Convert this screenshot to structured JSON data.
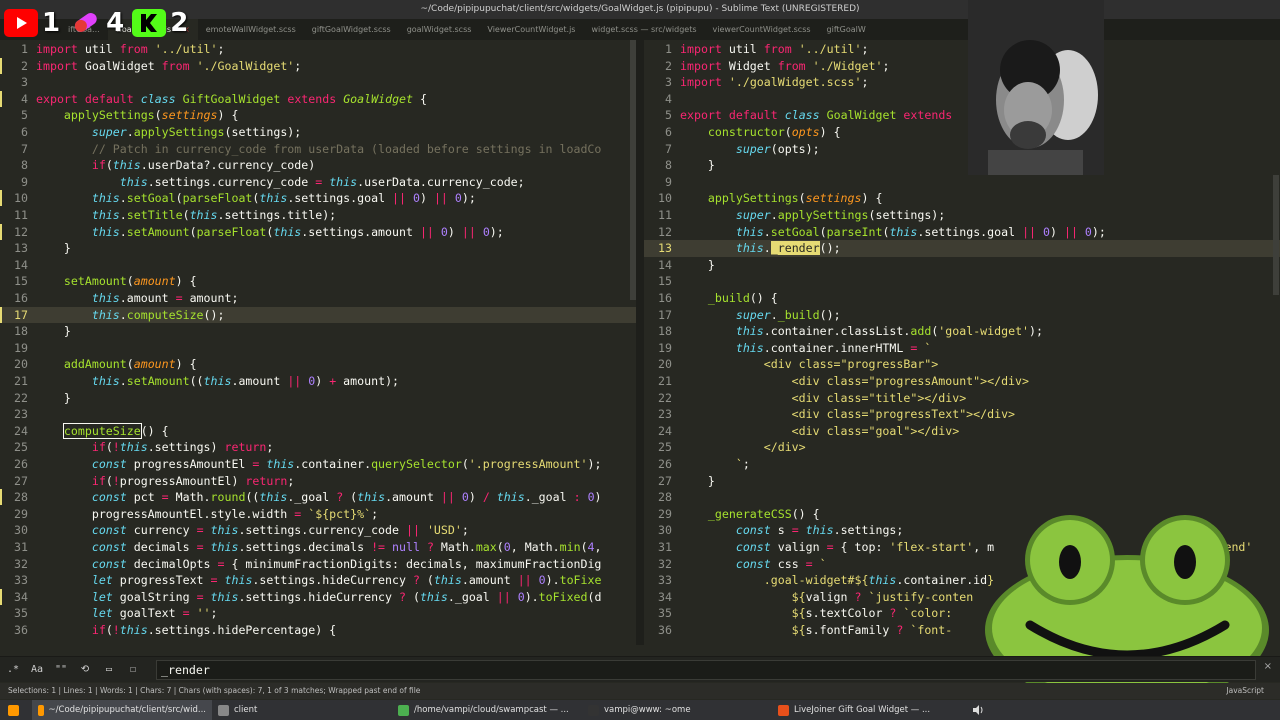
{
  "window_title": "~/Code/pipipupuchat/client/src/widgets/GoalWidget.js (pipipupu) - Sublime Text (UNREGISTERED)",
  "stream_icons": {
    "youtube_count": "1",
    "pill_count": "4",
    "kick_count": "2"
  },
  "tabs": [
    {
      "label": "iftGoa...",
      "active": false
    },
    {
      "label": "GoalWidget.js",
      "active": true
    },
    {
      "label": "emoteWallWidget.scss",
      "active": false
    },
    {
      "label": "giftGoalWidget.scss",
      "active": false
    },
    {
      "label": "goalWidget.scss",
      "active": false
    },
    {
      "label": "ViewerCountWidget.js",
      "active": false
    },
    {
      "label": "widget.scss — src/widgets",
      "active": false
    },
    {
      "label": "viewerCountWidget.scss",
      "active": false
    },
    {
      "label": "giftGoalW",
      "active": false
    }
  ],
  "tab_close_glyph": "×",
  "left_editor": {
    "lines": [
      {
        "n": "1",
        "mod": false,
        "cur": false,
        "html": "<span class='kw'>import</span> util <span class='kw'>from</span> <span class='st'>'../util'</span>;"
      },
      {
        "n": "2",
        "mod": true,
        "cur": false,
        "html": "<span class='kw'>import</span> GoalWidget <span class='kw'>from</span> <span class='st'>'./GoalWidget'</span>;"
      },
      {
        "n": "3",
        "mod": false,
        "cur": false,
        "html": ""
      },
      {
        "n": "4",
        "mod": true,
        "cur": false,
        "html": "<span class='kw'>export</span> <span class='kw'>default</span> <span class='kwi'>class</span> <span class='fn'>GiftGoalWidget</span> <span class='kw'>extends</span> <span class='cl'>GoalWidget</span> {"
      },
      {
        "n": "5",
        "mod": false,
        "cur": false,
        "html": "    <span class='fn'>applySettings</span>(<span class='pa'>settings</span>) {"
      },
      {
        "n": "6",
        "mod": false,
        "cur": false,
        "html": "        <span class='kwi'>super</span>.<span class='fn'>applySettings</span>(settings);"
      },
      {
        "n": "7",
        "mod": false,
        "cur": false,
        "html": "        <span class='cm'>// Patch in currency_code from userData (loaded before settings in loadCo</span>"
      },
      {
        "n": "8",
        "mod": false,
        "cur": false,
        "html": "        <span class='kw'>if</span>(<span class='kwi'>this</span>.userData?.currency_code)"
      },
      {
        "n": "9",
        "mod": false,
        "cur": false,
        "html": "            <span class='kwi'>this</span>.settings.currency_code <span class='kw'>=</span> <span class='kwi'>this</span>.userData.currency_code;"
      },
      {
        "n": "10",
        "mod": true,
        "cur": false,
        "html": "        <span class='kwi'>this</span>.<span class='fn'>setGoal</span>(<span class='fn'>parseFloat</span>(<span class='kwi'>this</span>.settings.goal <span class='kw'>||</span> <span class='nu'>0</span>) <span class='kw'>||</span> <span class='nu'>0</span>);"
      },
      {
        "n": "11",
        "mod": false,
        "cur": false,
        "html": "        <span class='kwi'>this</span>.<span class='fn'>setTitle</span>(<span class='kwi'>this</span>.settings.title);"
      },
      {
        "n": "12",
        "mod": true,
        "cur": false,
        "html": "        <span class='kwi'>this</span>.<span class='fn'>setAmount</span>(<span class='fn'>parseFloat</span>(<span class='kwi'>this</span>.settings.amount <span class='kw'>||</span> <span class='nu'>0</span>) <span class='kw'>||</span> <span class='nu'>0</span>);"
      },
      {
        "n": "13",
        "mod": false,
        "cur": false,
        "html": "    }"
      },
      {
        "n": "14",
        "mod": false,
        "cur": false,
        "html": ""
      },
      {
        "n": "15",
        "mod": false,
        "cur": false,
        "html": "    <span class='fn'>setAmount</span>(<span class='pa'>amount</span>) {"
      },
      {
        "n": "16",
        "mod": false,
        "cur": false,
        "html": "        <span class='kwi'>this</span>.amount <span class='kw'>=</span> amount;"
      },
      {
        "n": "17",
        "mod": true,
        "cur": true,
        "html": "        <span class='kwi'>this</span>.<span class='fn'>computeSize</span>();"
      },
      {
        "n": "18",
        "mod": false,
        "cur": false,
        "html": "    }"
      },
      {
        "n": "19",
        "mod": false,
        "cur": false,
        "html": ""
      },
      {
        "n": "20",
        "mod": false,
        "cur": false,
        "html": "    <span class='fn'>addAmount</span>(<span class='pa'>amount</span>) {"
      },
      {
        "n": "21",
        "mod": false,
        "cur": false,
        "html": "        <span class='kwi'>this</span>.<span class='fn'>setAmount</span>((<span class='kwi'>this</span>.amount <span class='kw'>||</span> <span class='nu'>0</span>) <span class='kw'>+</span> amount);"
      },
      {
        "n": "22",
        "mod": false,
        "cur": false,
        "html": "    }"
      },
      {
        "n": "23",
        "mod": false,
        "cur": false,
        "html": ""
      },
      {
        "n": "24",
        "mod": false,
        "cur": false,
        "html": "    <span class='fn hl'>computeSize</span>() {"
      },
      {
        "n": "25",
        "mod": false,
        "cur": false,
        "html": "        <span class='kw'>if</span>(<span class='kw'>!</span><span class='kwi'>this</span>.settings) <span class='kw'>return</span>;"
      },
      {
        "n": "26",
        "mod": false,
        "cur": false,
        "html": "        <span class='kwi'>const</span> progressAmountEl <span class='kw'>=</span> <span class='kwi'>this</span>.container.<span class='fn'>querySelector</span>(<span class='st'>'.progressAmount'</span>);"
      },
      {
        "n": "27",
        "mod": false,
        "cur": false,
        "html": "        <span class='kw'>if</span>(<span class='kw'>!</span>progressAmountEl) <span class='kw'>return</span>;"
      },
      {
        "n": "28",
        "mod": true,
        "cur": false,
        "html": "        <span class='kwi'>const</span> pct <span class='kw'>=</span> Math.<span class='fn'>round</span>((<span class='kwi'>this</span>._goal <span class='kw'>?</span> (<span class='kwi'>this</span>.amount <span class='kw'>||</span> <span class='nu'>0</span>) <span class='kw'>/</span> <span class='kwi'>this</span>._goal <span class='kw'>:</span> <span class='nu'>0</span>)"
      },
      {
        "n": "29",
        "mod": false,
        "cur": false,
        "html": "        progressAmountEl.style.width <span class='kw'>=</span> <span class='st'>`${pct}%`</span>;"
      },
      {
        "n": "30",
        "mod": false,
        "cur": false,
        "html": "        <span class='kwi'>const</span> currency <span class='kw'>=</span> <span class='kwi'>this</span>.settings.currency_code <span class='kw'>||</span> <span class='st'>'USD'</span>;"
      },
      {
        "n": "31",
        "mod": false,
        "cur": false,
        "html": "        <span class='kwi'>const</span> decimals <span class='kw'>=</span> <span class='kwi'>this</span>.settings.decimals <span class='kw'>!=</span> <span class='nu'>null</span> <span class='kw'>?</span> Math.<span class='fn'>max</span>(<span class='nu'>0</span>, Math.<span class='fn'>min</span>(<span class='nu'>4</span>,"
      },
      {
        "n": "32",
        "mod": false,
        "cur": false,
        "html": "        <span class='kwi'>const</span> decimalOpts <span class='kw'>=</span> { minimumFractionDigits: decimals, maximumFractionDig"
      },
      {
        "n": "33",
        "mod": false,
        "cur": false,
        "html": "        <span class='kwi'>let</span> progressText <span class='kw'>=</span> <span class='kwi'>this</span>.settings.hideCurrency <span class='kw'>?</span> (<span class='kwi'>this</span>.amount <span class='kw'>||</span> <span class='nu'>0</span>).<span class='fn'>toFixe</span>"
      },
      {
        "n": "34",
        "mod": true,
        "cur": false,
        "html": "        <span class='kwi'>let</span> goalString <span class='kw'>=</span> <span class='kwi'>this</span>.settings.hideCurrency <span class='kw'>?</span> (<span class='kwi'>this</span>._goal <span class='kw'>||</span> <span class='nu'>0</span>).<span class='fn'>toFixed</span>(d"
      },
      {
        "n": "35",
        "mod": false,
        "cur": false,
        "html": "        <span class='kwi'>let</span> goalText <span class='kw'>=</span> <span class='st'>''</span>;"
      },
      {
        "n": "36",
        "mod": false,
        "cur": false,
        "html": "        <span class='kw'>if</span>(<span class='kw'>!</span><span class='kwi'>this</span>.settings.hidePercentage) {"
      }
    ]
  },
  "right_editor": {
    "lines": [
      {
        "n": "1",
        "mod": false,
        "cur": false,
        "html": "<span class='kw'>import</span> util <span class='kw'>from</span> <span class='st'>'../util'</span>;"
      },
      {
        "n": "2",
        "mod": false,
        "cur": false,
        "html": "<span class='kw'>import</span> Widget <span class='kw'>from</span> <span class='st'>'./Widget'</span>;"
      },
      {
        "n": "3",
        "mod": false,
        "cur": false,
        "html": "<span class='kw'>import</span> <span class='st'>'./goalWidget.scss'</span>;"
      },
      {
        "n": "4",
        "mod": false,
        "cur": false,
        "html": ""
      },
      {
        "n": "5",
        "mod": false,
        "cur": false,
        "html": "<span class='kw'>export</span> <span class='kw'>default</span> <span class='kwi'>class</span> <span class='fn'>GoalWidget</span> <span class='kw'>extends</span>"
      },
      {
        "n": "6",
        "mod": false,
        "cur": false,
        "html": "    <span class='fn'>constructor</span>(<span class='pa'>opts</span>) {"
      },
      {
        "n": "7",
        "mod": false,
        "cur": false,
        "html": "        <span class='kwi'>super</span>(opts);"
      },
      {
        "n": "8",
        "mod": false,
        "cur": false,
        "html": "    }"
      },
      {
        "n": "9",
        "mod": false,
        "cur": false,
        "html": ""
      },
      {
        "n": "10",
        "mod": false,
        "cur": false,
        "html": "    <span class='fn'>applySettings</span>(<span class='pa'>settings</span>) {"
      },
      {
        "n": "11",
        "mod": false,
        "cur": false,
        "html": "        <span class='kwi'>super</span>.<span class='fn'>applySettings</span>(settings);"
      },
      {
        "n": "12",
        "mod": false,
        "cur": false,
        "html": "        <span class='kwi'>this</span>.<span class='fn'>setGoal</span>(<span class='fn'>parseInt</span>(<span class='kwi'>this</span>.settings.goal <span class='kw'>||</span> <span class='nu'>0</span>) <span class='kw'>||</span> <span class='nu'>0</span>);"
      },
      {
        "n": "13",
        "mod": false,
        "cur": true,
        "html": "        <span class='kwi'>this</span>.<span class='hlsel'>_render</span>();"
      },
      {
        "n": "14",
        "mod": false,
        "cur": false,
        "html": "    }"
      },
      {
        "n": "15",
        "mod": false,
        "cur": false,
        "html": ""
      },
      {
        "n": "16",
        "mod": false,
        "cur": false,
        "html": "    <span class='fn'>_build</span>() {"
      },
      {
        "n": "17",
        "mod": false,
        "cur": false,
        "html": "        <span class='kwi'>super</span>.<span class='fn'>_build</span>();"
      },
      {
        "n": "18",
        "mod": false,
        "cur": false,
        "html": "        <span class='kwi'>this</span>.container.classList.<span class='fn'>add</span>(<span class='st'>'goal-widget'</span>);"
      },
      {
        "n": "19",
        "mod": false,
        "cur": false,
        "html": "        <span class='kwi'>this</span>.container.innerHTML <span class='kw'>=</span> <span class='st'>`</span>"
      },
      {
        "n": "20",
        "mod": false,
        "cur": false,
        "html": "<span class='st'>            &lt;div class=\"progressBar\"&gt;</span>"
      },
      {
        "n": "21",
        "mod": false,
        "cur": false,
        "html": "<span class='st'>                &lt;div class=\"progressAmount\"&gt;&lt;/div&gt;</span>"
      },
      {
        "n": "22",
        "mod": false,
        "cur": false,
        "html": "<span class='st'>                &lt;div class=\"title\"&gt;&lt;/div&gt;</span>"
      },
      {
        "n": "23",
        "mod": false,
        "cur": false,
        "html": "<span class='st'>                &lt;div class=\"progressText\"&gt;&lt;/div&gt;</span>"
      },
      {
        "n": "24",
        "mod": false,
        "cur": false,
        "html": "<span class='st'>                &lt;div class=\"goal\"&gt;&lt;/div&gt;</span>"
      },
      {
        "n": "25",
        "mod": false,
        "cur": false,
        "html": "<span class='st'>            &lt;/div&gt;</span>"
      },
      {
        "n": "26",
        "mod": false,
        "cur": false,
        "html": "<span class='st'>        `</span>;"
      },
      {
        "n": "27",
        "mod": false,
        "cur": false,
        "html": "    }"
      },
      {
        "n": "28",
        "mod": false,
        "cur": false,
        "html": ""
      },
      {
        "n": "29",
        "mod": false,
        "cur": false,
        "html": "    <span class='fn'>_generateCSS</span>() {"
      },
      {
        "n": "30",
        "mod": false,
        "cur": false,
        "html": "        <span class='kwi'>const</span> s <span class='kw'>=</span> <span class='kwi'>this</span>.settings;"
      },
      {
        "n": "31",
        "mod": false,
        "cur": false,
        "html": "        <span class='kwi'>const</span> valign <span class='kw'>=</span> { top: <span class='st'>'flex-start'</span>, m                              <span class='st'>ex-end'</span>"
      },
      {
        "n": "32",
        "mod": false,
        "cur": false,
        "html": "        <span class='kwi'>const</span> css <span class='kw'>=</span> <span class='st'>`</span>"
      },
      {
        "n": "33",
        "mod": false,
        "cur": false,
        "html": "<span class='st'>            .goal-widget#${</span><span class='kwi'>this</span>.container.id<span class='st'>}</span>"
      },
      {
        "n": "34",
        "mod": false,
        "cur": false,
        "html": "<span class='st'>                ${</span>valign <span class='kw'>?</span> <span class='st'>`justify-conten</span>"
      },
      {
        "n": "35",
        "mod": false,
        "cur": false,
        "html": "<span class='st'>                ${</span>s.textColor <span class='kw'>?</span> <span class='st'>`color: </span>"
      },
      {
        "n": "36",
        "mod": false,
        "cur": false,
        "html": "<span class='st'>                ${</span>s.fontFamily <span class='kw'>?</span> <span class='st'>`font-</span>"
      }
    ]
  },
  "find_bar": {
    "regex_label": ".*",
    "case_label": "Aa",
    "word_label": "\"\"",
    "wrap_label": "⟲",
    "selection_label": "▭",
    "highlight_label": "☐",
    "query": "_render",
    "close_label": "×"
  },
  "status": {
    "left": "Selections: 1 | Lines: 1 | Words: 1 | Chars: 7 | Chars (with spaces): 7, 1 of 3 matches; Wrapped past end of file",
    "syntax": "JavaScript"
  },
  "taskbar": [
    {
      "label": "~/Code/pipipupuchat/client/src/wid...",
      "active": true,
      "icon_color": "#ff9800"
    },
    {
      "label": "client",
      "active": false,
      "icon_color": "#888888"
    },
    {
      "label": "/home/vampi/cloud/swampcast — ...",
      "active": false,
      "icon_color": "#4caf50"
    },
    {
      "label": "vampi@www: ~ome",
      "active": false,
      "icon_color": "#333333"
    },
    {
      "label": "LiveJoiner Gift Goal Widget — ...",
      "active": false,
      "icon_color": "#e8501b"
    }
  ],
  "colors": {
    "editor_bg": "#272822",
    "keyword": "#f92672",
    "string": "#e6db74",
    "function": "#a6e22e",
    "frog_green": "#8bc53f"
  }
}
